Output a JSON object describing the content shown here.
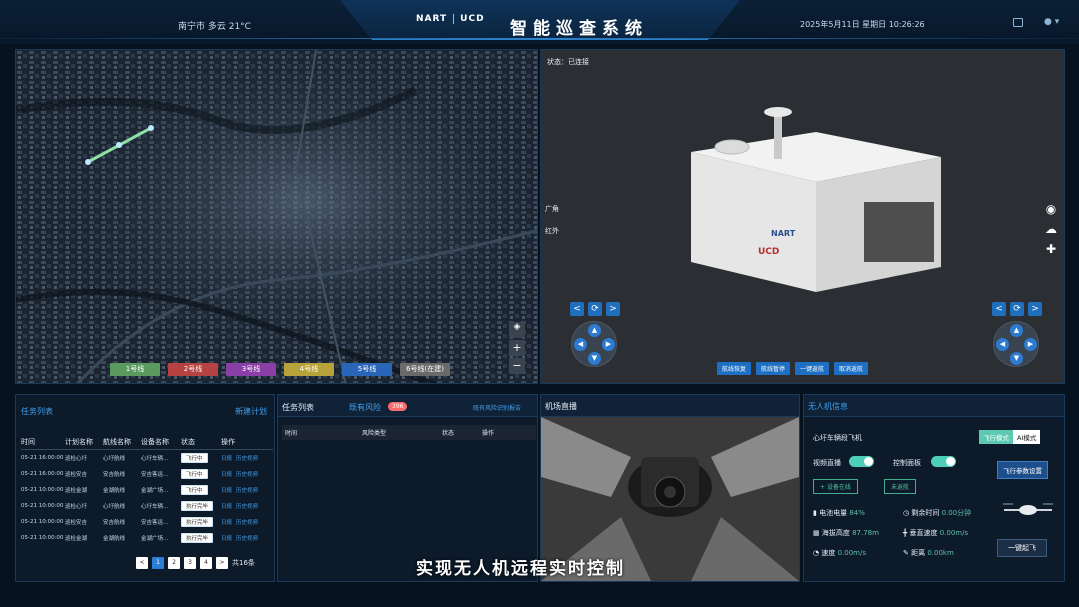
{
  "header": {
    "weather": "南宁市 多云 21°C",
    "logo_nart": "NART",
    "logo_ucd": "UCD",
    "title": "智能巡查系统",
    "datetime": "2025年5月11日 星期日 10:26:26"
  },
  "map": {
    "routes": [
      "1号线",
      "2号线",
      "3号线",
      "4号线",
      "5号线",
      "6号线(在建)"
    ],
    "route_colors": [
      "#5a9a5e",
      "#b74242",
      "#8a3fa6",
      "#b8a23a",
      "#2a66b8",
      "#6a6a6a"
    ],
    "zoom_in": "+",
    "zoom_out": "−"
  },
  "station": {
    "status": "状态：已连接",
    "tab_wide": "广角",
    "tab_ir": "红外",
    "btn_prev": "<",
    "btn_refresh": "⟳",
    "btn_next": ">",
    "actions": [
      "航线恢复",
      "航线暂停",
      "一键返航",
      "取消返航"
    ]
  },
  "tasks": {
    "title": "任务列表",
    "new_plan": "新建计划",
    "headers": [
      "时间",
      "计划名称",
      "航线名称",
      "设备名称",
      "状态",
      "操作"
    ],
    "rows": [
      {
        "time": "05-21 16:00:00",
        "plan": "巡检心圩",
        "route": "心圩航线",
        "device": "心圩车辆...",
        "status": "飞行中",
        "ops": [
          "日报",
          "历史视频"
        ]
      },
      {
        "time": "05-21 16:00:00",
        "plan": "巡检安吉",
        "route": "安吉航线",
        "device": "安吉客运...",
        "status": "飞行中",
        "ops": [
          "日报",
          "历史视频"
        ]
      },
      {
        "time": "05-21 10:00:00",
        "plan": "巡检金湖",
        "route": "金湖航线",
        "device": "金湖广场...",
        "status": "飞行中",
        "ops": [
          "日报",
          "历史视频"
        ]
      },
      {
        "time": "05-21 10:00:00",
        "plan": "巡检心圩",
        "route": "心圩航线",
        "device": "心圩车辆...",
        "status": "执行完毕",
        "ops": [
          "日报",
          "历史视频"
        ]
      },
      {
        "time": "05-21 10:00:00",
        "plan": "巡检安吉",
        "route": "安吉航线",
        "device": "安吉客运...",
        "status": "执行完毕",
        "ops": [
          "日报",
          "历史视频"
        ]
      },
      {
        "time": "05-21 10:00:00",
        "plan": "巡检金湖",
        "route": "金湖航线",
        "device": "金湖广场...",
        "status": "执行完毕",
        "ops": [
          "日报",
          "历史视频"
        ]
      }
    ],
    "pager": {
      "prev": "<",
      "pages": [
        "1",
        "2",
        "3",
        "4"
      ],
      "next": ">",
      "total": "共16条"
    }
  },
  "risk": {
    "tab_tasks": "任务列表",
    "tab_risk": "既有风险",
    "badge": "396",
    "report": "既有风险识别报告",
    "headers": [
      "时间",
      "风险类型",
      "状态",
      "操作"
    ]
  },
  "live": {
    "title": "机场直播"
  },
  "drone": {
    "title": "无人机信息",
    "name": "心圩车辆段飞机",
    "mode_flight": "飞行模式",
    "mode_ai": "AI模式",
    "video_live": "视频直播",
    "control_panel": "控制面板",
    "flight_params": "飞行参数设置",
    "device_online": "+ 设备在线",
    "not_returned": "未返航",
    "battery_label": "电池电量",
    "battery": "84%",
    "remaining_label": "剩余时间",
    "remaining": "0.00分钟",
    "altitude_label": "海拔高度",
    "altitude": "87.78m",
    "vspeed_label": "垂直速度",
    "vspeed": "0.00m/s",
    "speed_label": "速度",
    "speed": "0.00m/s",
    "distance_label": "距离",
    "distance": "0.00km",
    "takeoff": "一键起飞"
  },
  "subtitle": "实现无人机远程实时控制"
}
